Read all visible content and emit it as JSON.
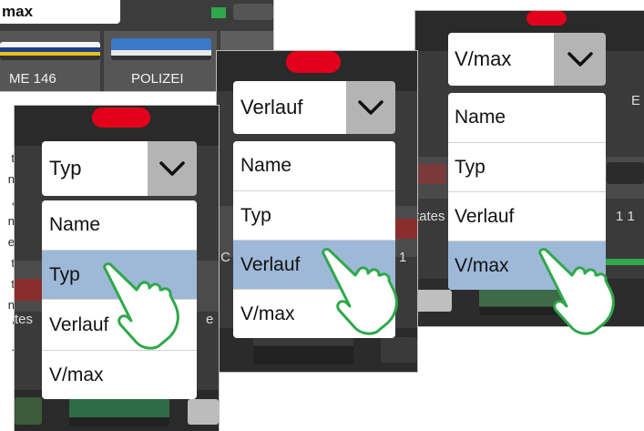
{
  "loco_list_panel": {
    "search_field_text": "max",
    "tiles": [
      {
        "label": "ME 146"
      },
      {
        "label": "POLIZEI"
      }
    ]
  },
  "left_edge_text": [
    "t",
    "n",
    ",",
    "n",
    "e",
    "t",
    "t",
    "n",
    "'",
    "."
  ],
  "panel_typ": {
    "dropdown": {
      "selected_value": "Typ"
    },
    "menu": {
      "options": [
        "Name",
        "Typ",
        "Verlauf",
        "V/max"
      ],
      "highlighted": "Typ"
    },
    "peek_text_left": "tes",
    "peek_text_right": "e"
  },
  "panel_verlauf": {
    "dropdown": {
      "selected_value": "Verlauf"
    },
    "menu": {
      "options": [
        "Name",
        "Typ",
        "Verlauf",
        "V/max"
      ],
      "highlighted": "Verlauf"
    },
    "peek_text_left": "IC",
    "peek_text_right": "1"
  },
  "panel_vmax": {
    "dropdown": {
      "selected_value": "V/max"
    },
    "menu": {
      "options": [
        "Name",
        "Typ",
        "Verlauf",
        "V/max"
      ],
      "highlighted": "V/max"
    },
    "peek_text_left": "tates",
    "peek_text_right": "1 1",
    "peek_text_top": "E"
  },
  "colors": {
    "highlight": "#9eb8d8",
    "indicator_red": "#e3001b",
    "hand_outline": "#2ea84a",
    "chevron_bg": "#b4b4b4"
  },
  "icons": [
    "chevron-down-icon",
    "pointing-hand-icon"
  ]
}
